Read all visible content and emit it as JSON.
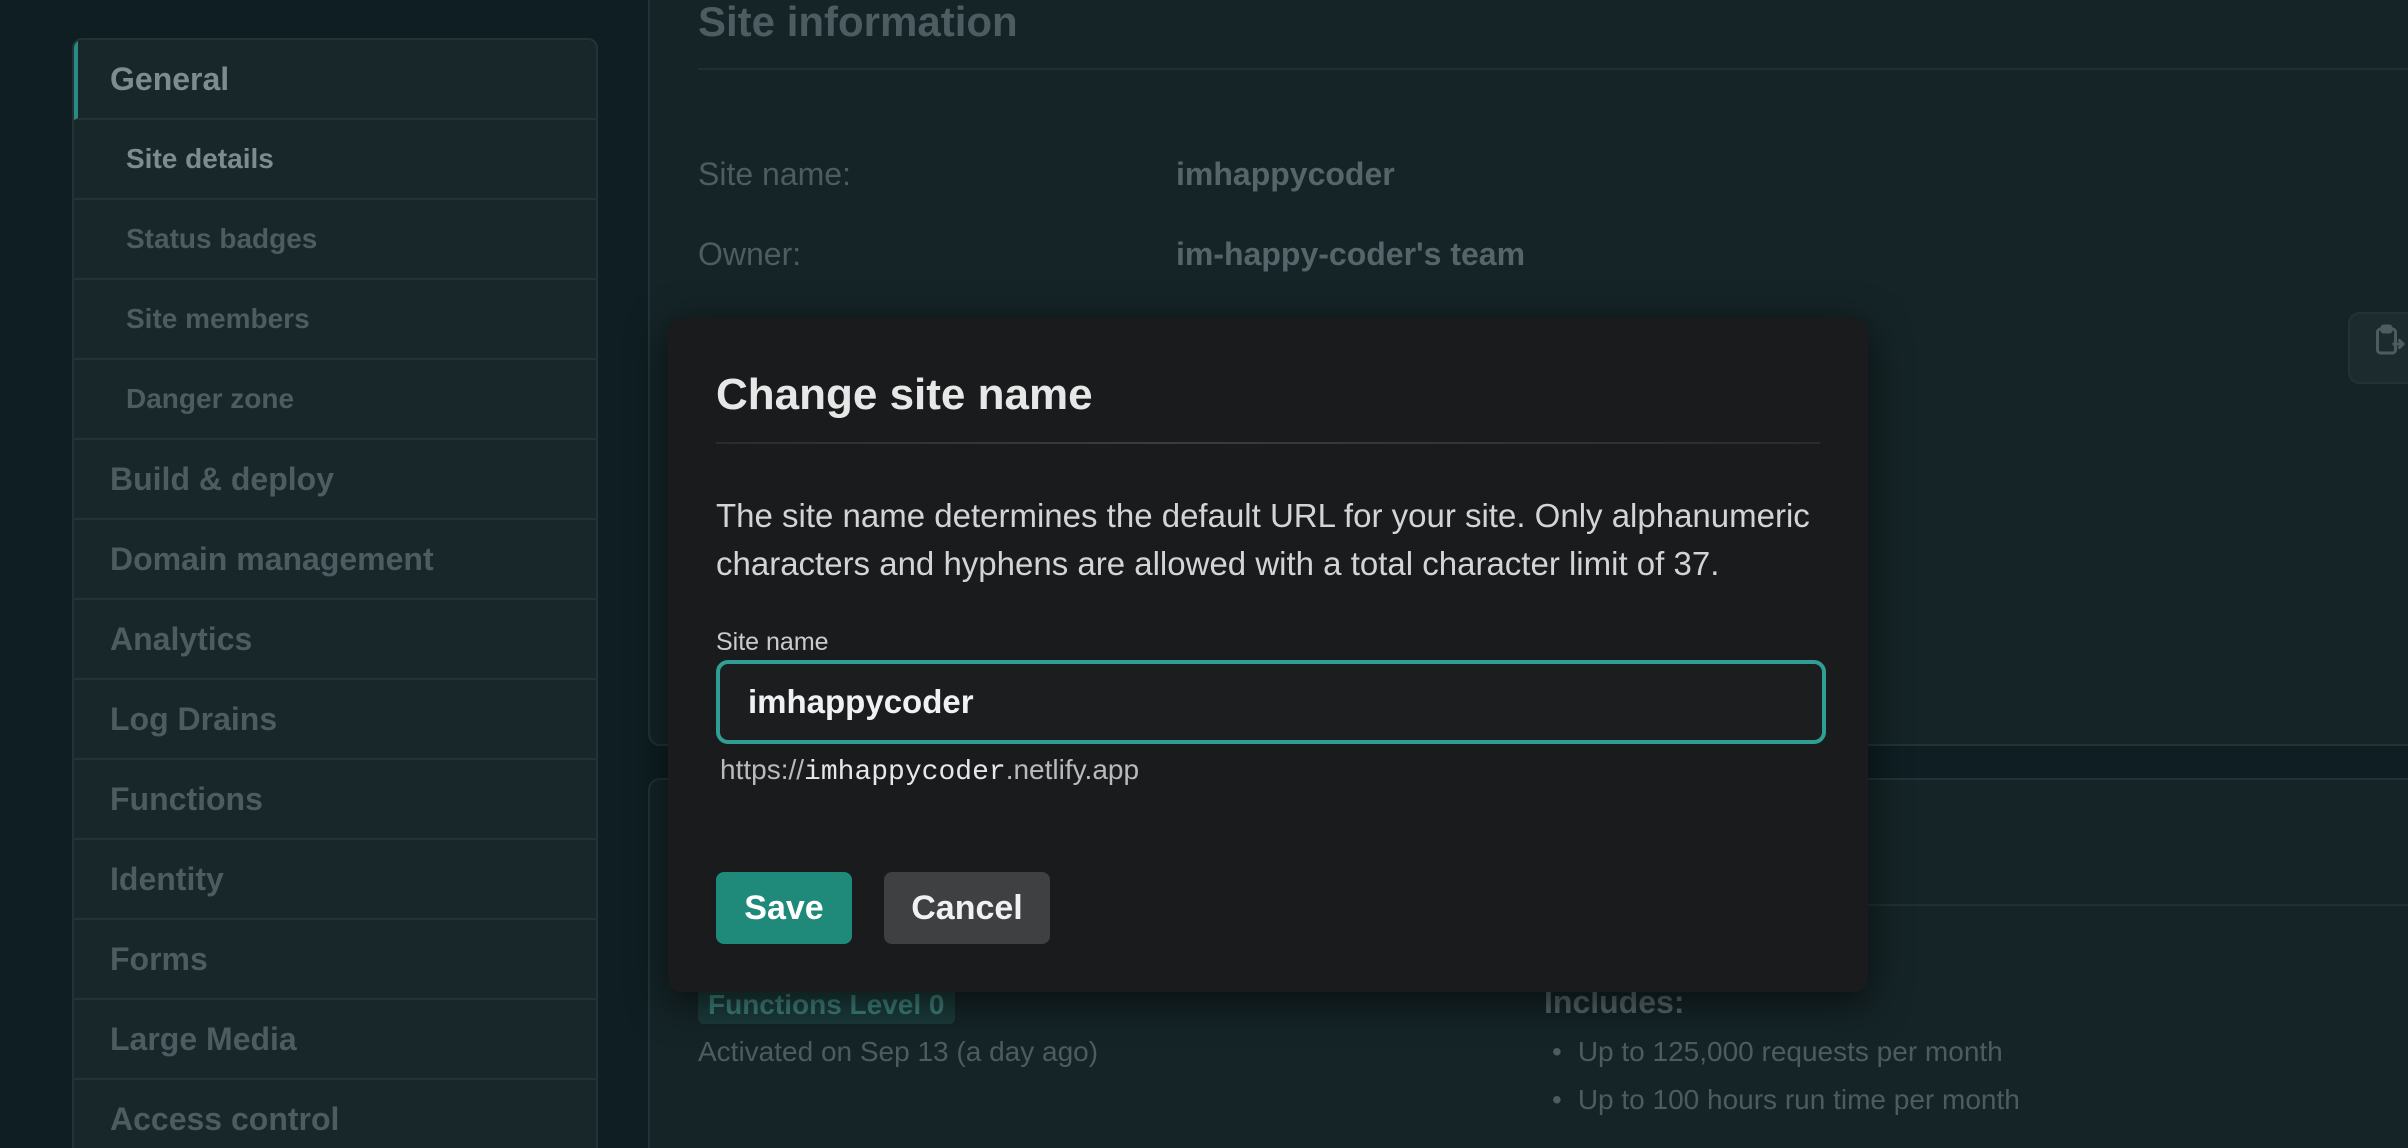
{
  "sidebar": {
    "items": [
      {
        "label": "General"
      },
      {
        "label": "Site details"
      },
      {
        "label": "Status badges"
      },
      {
        "label": "Site members"
      },
      {
        "label": "Danger zone"
      },
      {
        "label": "Build & deploy"
      },
      {
        "label": "Domain management"
      },
      {
        "label": "Analytics"
      },
      {
        "label": "Log Drains"
      },
      {
        "label": "Functions"
      },
      {
        "label": "Identity"
      },
      {
        "label": "Forms"
      },
      {
        "label": "Large Media"
      },
      {
        "label": "Access control"
      }
    ]
  },
  "site_info": {
    "title": "Site information",
    "site_name_label": "Site name:",
    "site_name_value": "imhappycoder",
    "owner_label": "Owner:",
    "owner_value": "im-happy-coder's team",
    "side_button_icon": "clipboard-icon"
  },
  "functions": {
    "level_badge": "Functions Level 0",
    "activated": "Activated on Sep 13 (a day ago)",
    "includes_title": "Includes:",
    "includes": [
      "Up to 125,000 requests per month",
      "Up to 100 hours run time per month"
    ]
  },
  "modal": {
    "title": "Change site name",
    "description": "The site name determines the default URL for your site. Only alphanumeric characters and hyphens are allowed with a total character limit of 37.",
    "field_label": "Site name",
    "field_value": "imhappycoder",
    "url_prefix": "https://",
    "url_name": "imhappycoder",
    "url_suffix": ".netlify.app",
    "save_label": "Save",
    "cancel_label": "Cancel"
  },
  "colors": {
    "accent": "#2f9f95",
    "save_button": "#1f8a7a",
    "background": "#0e1e22"
  }
}
